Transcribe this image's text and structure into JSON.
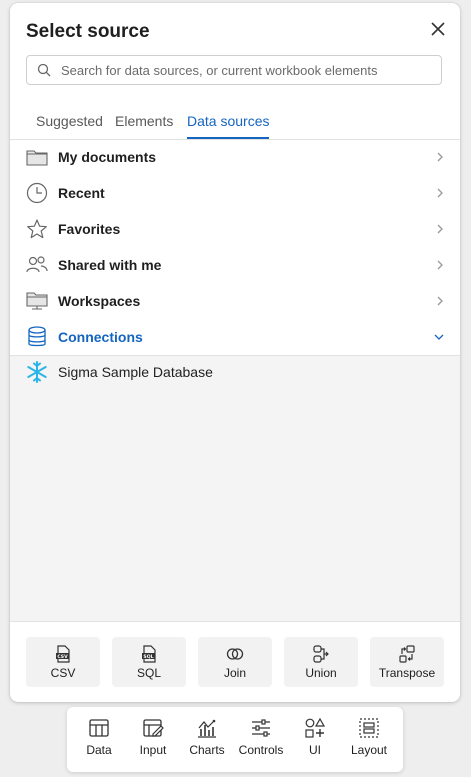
{
  "dialog": {
    "title": "Select source",
    "search_placeholder": "Search for data sources, or current workbook elements"
  },
  "tabs": [
    {
      "label": "Suggested",
      "active": false
    },
    {
      "label": "Elements",
      "active": false
    },
    {
      "label": "Data sources",
      "active": true
    }
  ],
  "sources": [
    {
      "label": "My documents",
      "icon": "folder-icon"
    },
    {
      "label": "Recent",
      "icon": "clock-icon"
    },
    {
      "label": "Favorites",
      "icon": "star-icon"
    },
    {
      "label": "Shared with me",
      "icon": "people-icon"
    },
    {
      "label": "Workspaces",
      "icon": "workspace-icon"
    },
    {
      "label": "Connections",
      "icon": "database-icon",
      "expanded": true
    }
  ],
  "connections": [
    {
      "label": "Sigma Sample Database",
      "icon": "snowflake-icon"
    }
  ],
  "actions": [
    {
      "label": "CSV",
      "icon": "csv-file-icon"
    },
    {
      "label": "SQL",
      "icon": "sql-file-icon"
    },
    {
      "label": "Join",
      "icon": "join-icon"
    },
    {
      "label": "Union",
      "icon": "union-icon"
    },
    {
      "label": "Transpose",
      "icon": "transpose-icon"
    }
  ],
  "toolbar": [
    {
      "label": "Data",
      "icon": "table-icon"
    },
    {
      "label": "Input",
      "icon": "input-icon"
    },
    {
      "label": "Charts",
      "icon": "chart-icon"
    },
    {
      "label": "Controls",
      "icon": "sliders-icon"
    },
    {
      "label": "UI",
      "icon": "shapes-icon"
    },
    {
      "label": "Layout",
      "icon": "layout-icon"
    }
  ],
  "colors": {
    "accent": "#1565c0",
    "snowflake": "#29b5e8",
    "text": "#1f1f1f",
    "muted": "#595959"
  }
}
